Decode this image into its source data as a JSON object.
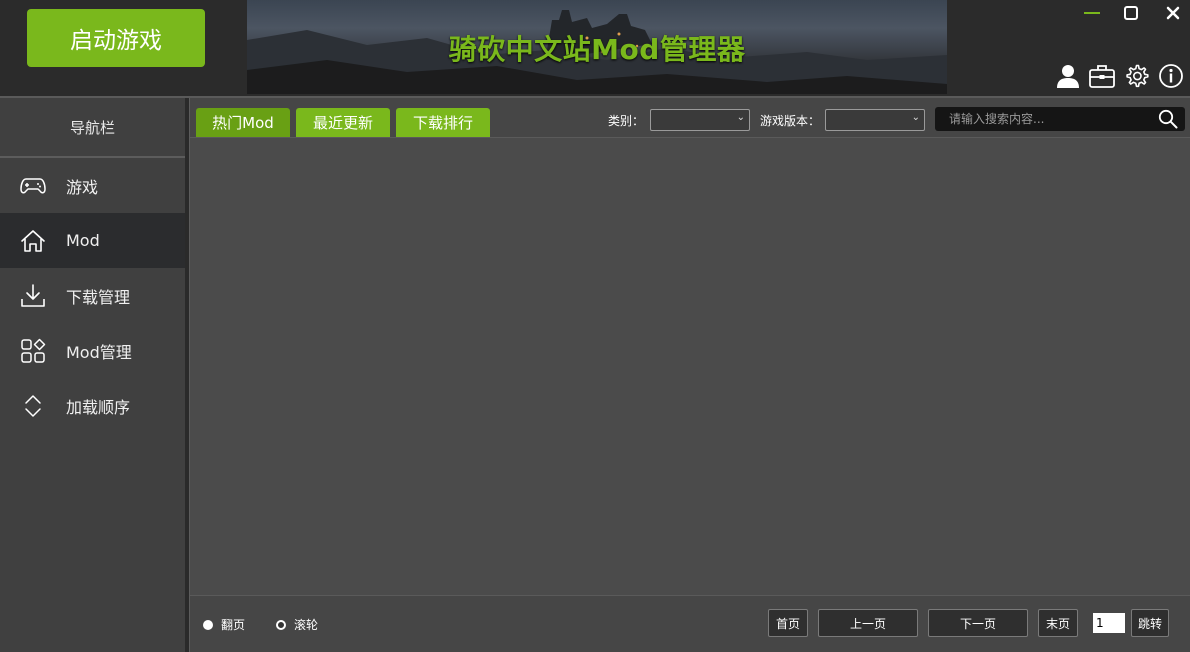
{
  "header": {
    "launch_label": "启动游戏",
    "banner_title": "骑砍中文站Mod管理器",
    "window_controls": {
      "minimize": "minimize-icon",
      "maximize": "maximize-icon",
      "close": "close-icon"
    },
    "toolbar_icons": [
      "user-icon",
      "briefcase-icon",
      "gear-icon",
      "info-icon"
    ]
  },
  "sidebar": {
    "title": "导航栏",
    "items": [
      {
        "label": "游戏",
        "icon": "gamepad-icon",
        "active": false
      },
      {
        "label": "Mod",
        "icon": "home-icon",
        "active": true
      },
      {
        "label": "下载管理",
        "icon": "download-icon",
        "active": false
      },
      {
        "label": "Mod管理",
        "icon": "grid-icon",
        "active": false
      },
      {
        "label": "加载顺序",
        "icon": "sort-icon",
        "active": false
      }
    ]
  },
  "main": {
    "tabs": [
      {
        "label": "热门Mod",
        "active": true
      },
      {
        "label": "最近更新",
        "active": false
      },
      {
        "label": "下载排行",
        "active": false
      }
    ],
    "filters": {
      "category_label": "类别：",
      "category_value": "",
      "version_label": "游戏版本：",
      "version_value": ""
    },
    "search": {
      "placeholder": "请输入搜索内容...",
      "value": ""
    }
  },
  "footer": {
    "modes": [
      {
        "label": "翻页",
        "selected": true
      },
      {
        "label": "滚轮",
        "selected": false
      }
    ],
    "first_label": "首页",
    "prev_label": "上一页",
    "next_label": "下一页",
    "last_label": "末页",
    "page_value": "1",
    "jump_label": "跳转"
  },
  "colors": {
    "accent": "#7ab81c",
    "accent_active": "#69a014",
    "panel": "#4a4a4a",
    "sidebar": "#404040",
    "active_nav": "#2b2c2e"
  }
}
